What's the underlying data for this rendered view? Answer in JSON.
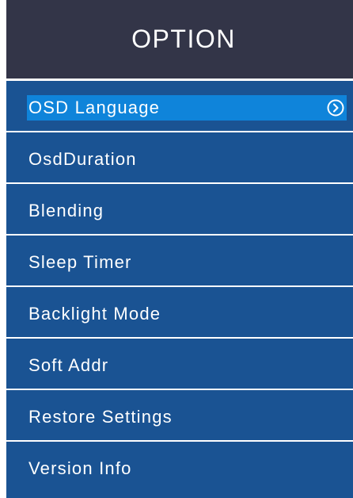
{
  "header": {
    "title": "OPTION"
  },
  "menu": {
    "selected_index": 0,
    "items": [
      {
        "label": "OSD Language",
        "icon": "chevron-right-circle-icon"
      },
      {
        "label": "OsdDuration"
      },
      {
        "label": "Blending"
      },
      {
        "label": "Sleep Timer"
      },
      {
        "label": "Backlight Mode"
      },
      {
        "label": "Soft Addr"
      },
      {
        "label": "Restore Settings"
      },
      {
        "label": "Version Info"
      }
    ]
  },
  "colors": {
    "header_bg": "#333548",
    "panel_bg": "#1a5393",
    "highlight": "#0f84da",
    "text": "#ffffff"
  }
}
